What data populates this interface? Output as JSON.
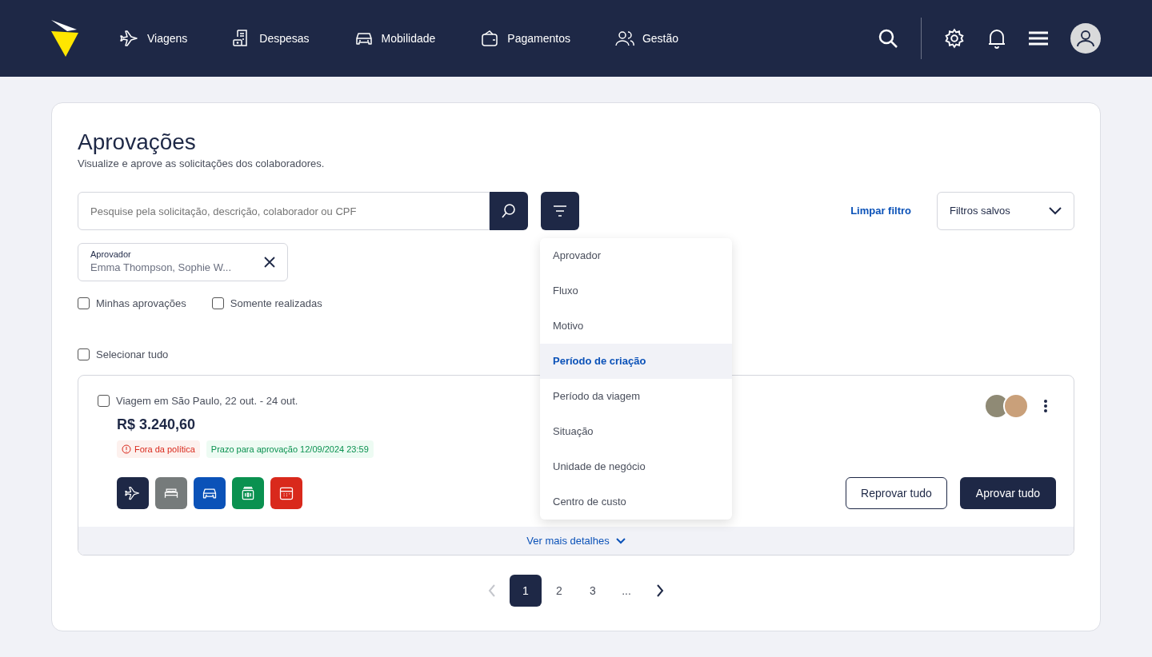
{
  "nav": {
    "items": [
      {
        "kind": "plane",
        "label": "Viagens"
      },
      {
        "kind": "receipt",
        "label": "Despesas"
      },
      {
        "kind": "car",
        "label": "Mobilidade"
      },
      {
        "kind": "wallet",
        "label": "Pagamentos"
      },
      {
        "kind": "users",
        "label": "Gestão"
      }
    ]
  },
  "page": {
    "title": "Aprovações",
    "subtitle": "Visualize e aprove as solicitações dos colaboradores."
  },
  "search": {
    "placeholder": "Pesquise pela solicitação, descrição, colaborador ou CPF"
  },
  "clear_filter": "Limpar filtro",
  "saved_filters": {
    "label": "Filtros salvos"
  },
  "chip": {
    "label": "Aprovador",
    "value": "Emma Thompson, Sophie W..."
  },
  "checkboxes": [
    {
      "label": "Minhas aprovações",
      "checked": false
    },
    {
      "label": "Somente realizadas",
      "checked": false
    }
  ],
  "select_all": {
    "label": "Selecionar tudo",
    "checked": false
  },
  "filter_menu": [
    {
      "label": "Aprovador",
      "selected": false
    },
    {
      "label": "Fluxo",
      "selected": false
    },
    {
      "label": "Motivo",
      "selected": false
    },
    {
      "label": "Período de criação",
      "selected": true
    },
    {
      "label": "Período da viagem",
      "selected": false
    },
    {
      "label": "Situação",
      "selected": false
    },
    {
      "label": "Unidade de negócio",
      "selected": false
    },
    {
      "label": "Centro de custo",
      "selected": false
    }
  ],
  "request": {
    "title": "Viagem em São Paulo, 22 out. - 24 out.",
    "checked": false,
    "amount": "R$ 3.240,60",
    "tags": [
      {
        "kind": "danger",
        "text": "Fora da política"
      },
      {
        "kind": "success",
        "text": "Prazo para aprovação 12/09/2024 23:59"
      }
    ],
    "services": [
      {
        "kind": "plane",
        "color": "#1e2846"
      },
      {
        "kind": "bed",
        "color": "#767b7b"
      },
      {
        "kind": "car",
        "color": "#0b52b8"
      },
      {
        "kind": "money",
        "color": "#0a9150"
      },
      {
        "kind": "calendar",
        "color": "#d9291c"
      }
    ],
    "reject_button": "Reprovar tudo",
    "approve_button": "Aprovar tudo",
    "details_link": "Ver mais detalhes"
  },
  "pagination": {
    "prev_disabled": true,
    "pages": [
      {
        "label": "1",
        "selected": true
      },
      {
        "label": "2",
        "selected": false
      },
      {
        "label": "3",
        "selected": false
      },
      {
        "label": "...",
        "selected": false
      }
    ]
  }
}
